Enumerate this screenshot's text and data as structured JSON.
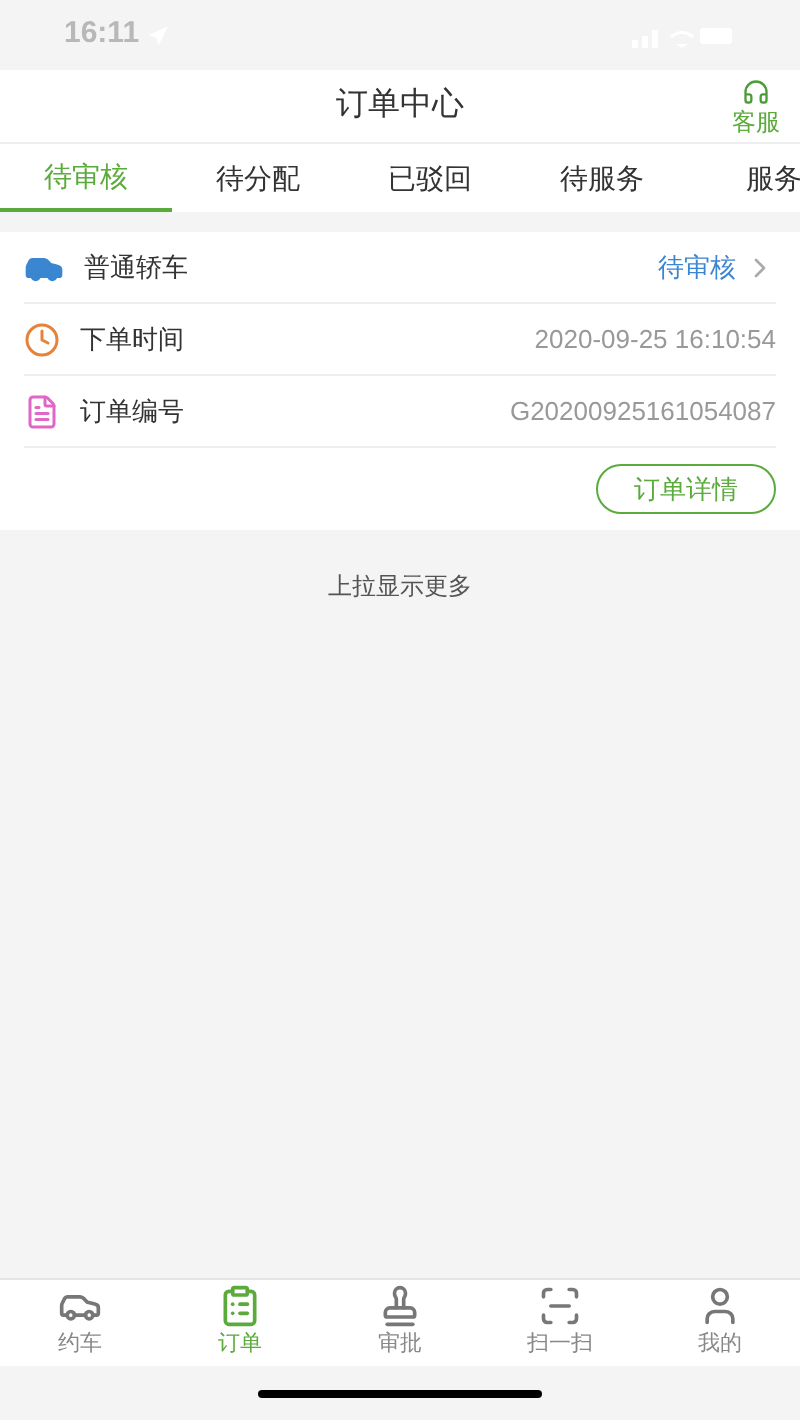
{
  "status_bar": {
    "time": "16:11"
  },
  "header": {
    "title": "订单中心",
    "service_label": "客服"
  },
  "tabs": [
    {
      "label": "待审核",
      "selected": true
    },
    {
      "label": "待分配",
      "selected": false
    },
    {
      "label": "已驳回",
      "selected": false
    },
    {
      "label": "待服务",
      "selected": false
    },
    {
      "label": "服务",
      "selected": false
    }
  ],
  "order": {
    "rows": [
      {
        "kind": "car",
        "label": "普通轿车",
        "value": "待审核"
      },
      {
        "kind": "time",
        "label": "下单时间",
        "value": "2020-09-25 16:10:54"
      },
      {
        "kind": "number",
        "label": "订单编号",
        "value": "G20200925161054087"
      }
    ],
    "detail_button": "订单详情"
  },
  "footer_hint": "上拉显示更多",
  "bottom_nav": [
    {
      "kind": "car",
      "label": "约车",
      "selected": false
    },
    {
      "kind": "order",
      "label": "订单",
      "selected": true
    },
    {
      "kind": "approve",
      "label": "审批",
      "selected": false
    },
    {
      "kind": "scan",
      "label": "扫一扫",
      "selected": false
    },
    {
      "kind": "me",
      "label": "我的",
      "selected": false
    }
  ]
}
